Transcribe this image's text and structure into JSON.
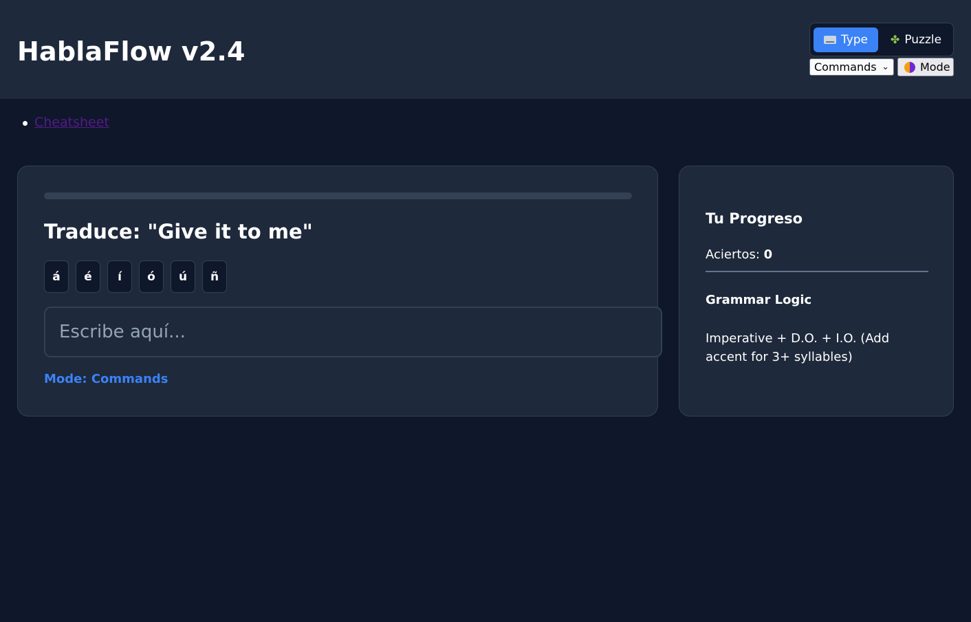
{
  "header": {
    "title": "HablaFlow v2.4",
    "view_toggle": {
      "type_label": "Type",
      "type_icon": "keyboard-icon",
      "puzzle_label": "Puzzle",
      "puzzle_icon": "puzzle-piece-icon",
      "active": "Type"
    },
    "mode_select": {
      "selected": "Commands"
    },
    "theme_button": {
      "label": "Mode",
      "icon": "half-moon-icon"
    }
  },
  "nav": {
    "links": [
      {
        "label": "Cheatsheet"
      }
    ]
  },
  "exercise": {
    "progress_percent": 0,
    "prompt": "Traduce: \"Give it to me\"",
    "accent_keys": [
      "á",
      "é",
      "í",
      "ó",
      "ú",
      "ñ"
    ],
    "input": {
      "placeholder": "Escribe aquí...",
      "value": ""
    },
    "mode_label": "Mode: Commands"
  },
  "sidebar": {
    "title": "Tu Progreso",
    "score_label": "Aciertos: ",
    "score_value": "0",
    "logic_title": "Grammar Logic",
    "logic_text": "Imperative + D.O. + I.O. (Add accent for 3+ syllables)"
  },
  "colors": {
    "background": "#0f172a",
    "surface": "#1e293b",
    "border": "#334155",
    "accent": "#3b82f6",
    "link": "#551a8b"
  }
}
